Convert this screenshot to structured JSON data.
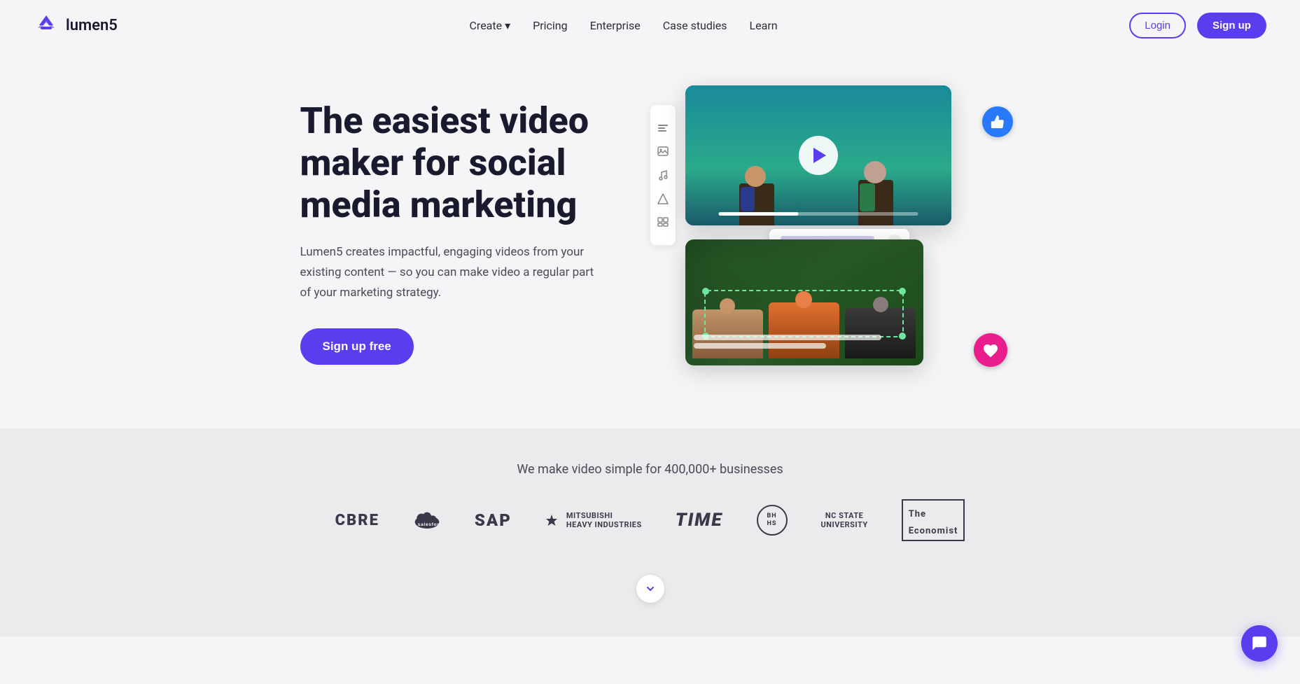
{
  "brand": {
    "name": "lumen5",
    "logo_alt": "Lumen5 logo"
  },
  "nav": {
    "create_label": "Create",
    "pricing_label": "Pricing",
    "enterprise_label": "Enterprise",
    "case_studies_label": "Case studies",
    "learn_label": "Learn",
    "login_label": "Login",
    "signup_label": "Sign up"
  },
  "hero": {
    "title": "The easiest video maker for social media marketing",
    "description": "Lumen5 creates impactful, engaging videos from your existing content — so you can make video a regular part of your marketing strategy.",
    "cta_label": "Sign up free"
  },
  "brands": {
    "tagline": "We make video simple for 400,000+ businesses",
    "logos": [
      {
        "name": "CBRE",
        "style": "text"
      },
      {
        "name": "salesforce",
        "style": "icon"
      },
      {
        "name": "SAP",
        "style": "text"
      },
      {
        "name": "Mitsubishi Heavy Industries",
        "style": "text-small"
      },
      {
        "name": "TIME",
        "style": "text"
      },
      {
        "name": "BHHS",
        "style": "circle"
      },
      {
        "name": "NC STATE UNIVERSITY",
        "style": "text-small"
      },
      {
        "name": "The Economist",
        "style": "box"
      }
    ]
  },
  "chat": {
    "icon": "💬"
  }
}
